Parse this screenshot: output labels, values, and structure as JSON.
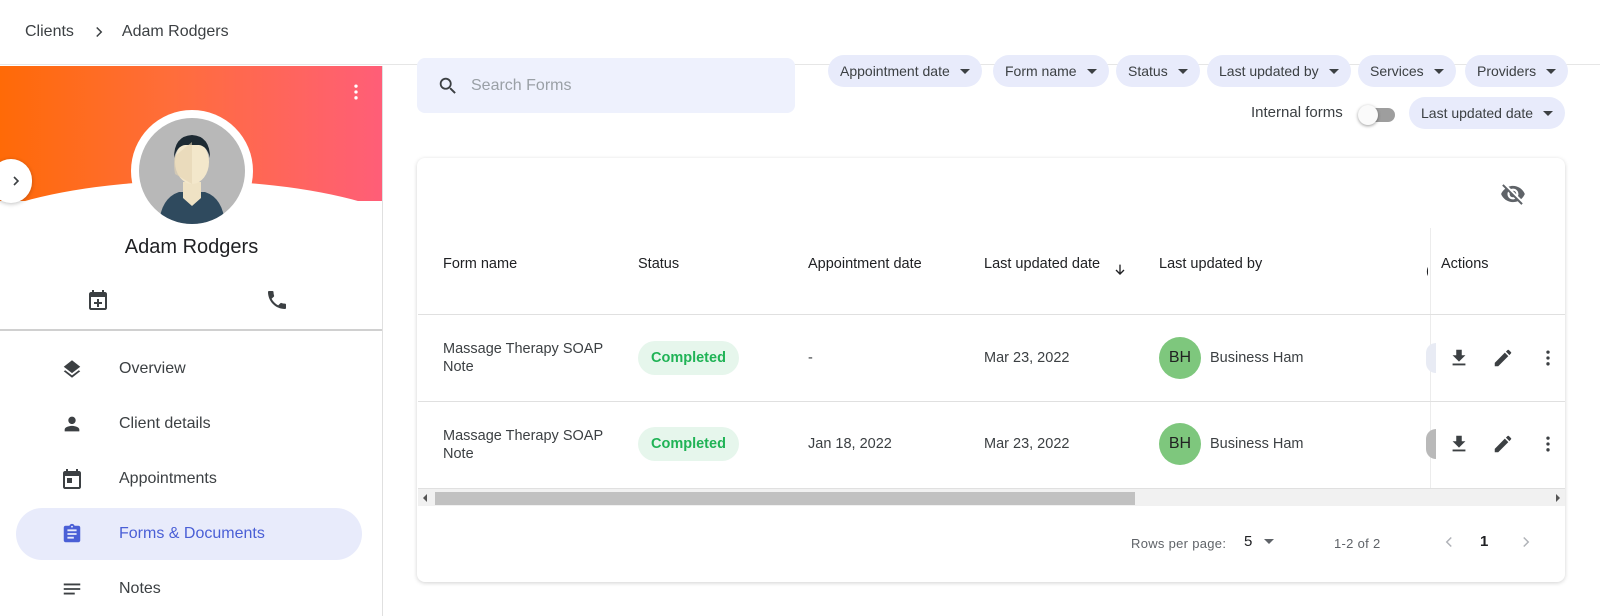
{
  "breadcrumb": {
    "root": "Clients",
    "current": "Adam Rodgers"
  },
  "client": {
    "name": "Adam Rodgers"
  },
  "nav": {
    "items": [
      {
        "label": "Overview",
        "icon": "layers-icon"
      },
      {
        "label": "Client details",
        "icon": "person-icon"
      },
      {
        "label": "Appointments",
        "icon": "calendar-icon"
      },
      {
        "label": "Forms & Documents",
        "icon": "clipboard-icon",
        "active": true
      },
      {
        "label": "Notes",
        "icon": "notes-icon"
      }
    ]
  },
  "search": {
    "placeholder": "Search Forms"
  },
  "filters": {
    "appointment_date": "Appointment date",
    "form_name": "Form name",
    "status": "Status",
    "last_updated_by": "Last updated by",
    "services": "Services",
    "providers": "Providers",
    "sort": "Last updated date"
  },
  "internal_forms": {
    "label": "Internal forms",
    "enabled": false
  },
  "table": {
    "columns": {
      "form_name": "Form name",
      "status": "Status",
      "appointment_date": "Appointment date",
      "last_updated_date": "Last updated date",
      "last_updated_by": "Last updated by",
      "actions": "Actions"
    },
    "rows": [
      {
        "form_name": "Massage Therapy SOAP Note",
        "status": "Completed",
        "appointment_date": "-",
        "last_updated_date": "Mar 23, 2022",
        "initials": "BH",
        "updated_by": "Business Ham"
      },
      {
        "form_name": "Massage Therapy SOAP Note",
        "status": "Completed",
        "appointment_date": "Jan 18, 2022",
        "last_updated_date": "Mar 23, 2022",
        "initials": "BH",
        "updated_by": "Business Ham"
      }
    ]
  },
  "pagination": {
    "rows_per_page_label": "Rows per page:",
    "rows_per_page": "5",
    "range": "1-2 of 2",
    "page": "1"
  },
  "colors": {
    "accent": "#4a5fd6",
    "status_completed": "#20b356",
    "avatar_green": "#7ec77d",
    "hero_start": "#ff6a07",
    "hero_end": "#ff5e78"
  }
}
